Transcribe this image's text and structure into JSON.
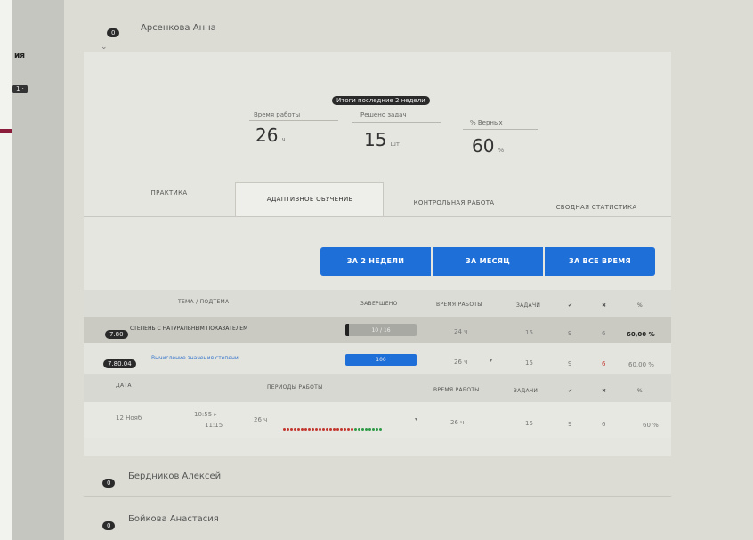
{
  "sidebar": {
    "label": "ия",
    "badge": "1 ·"
  },
  "students": [
    {
      "badge": "0",
      "name": "Арсенкова Анна"
    },
    {
      "badge": "0",
      "name": "Бердников Алексей"
    },
    {
      "badge": "0",
      "name": "Бойкова Анастасия"
    }
  ],
  "summary": {
    "period_label": "Итоги последние 2 недели",
    "items": [
      {
        "label": "Время работы",
        "value": "26",
        "unit": "ч"
      },
      {
        "label": "Решено задач",
        "value": "15",
        "unit": "шт"
      },
      {
        "label": "% Верных",
        "value": "60",
        "unit": "%"
      }
    ]
  },
  "tabs": [
    {
      "label": "ПРАКТИКА",
      "active": false
    },
    {
      "label": "АДАПТИВНОЕ ОБУЧЕНИЕ",
      "active": true
    },
    {
      "label": "КОНТРОЛЬНАЯ РАБОТА",
      "active": false
    },
    {
      "label": "СВОДНАЯ СТАТИСТИКА",
      "active": false
    }
  ],
  "period_buttons": [
    "ЗА 2 НЕДЕЛИ",
    "ЗА МЕСЯЦ",
    "ЗА ВСЕ ВРЕМЯ"
  ],
  "table": {
    "headers": [
      "ТЕМА / ПОДТЕМА",
      "ЗАВЕРШЕНО",
      "ВРЕМЯ РАБОТЫ",
      "ЗАДАЧИ",
      "✔",
      "✖",
      "%"
    ],
    "rows": [
      {
        "badge": "7.80",
        "topic": "СТЕПЕНЬ С НАТУРАЛЬНЫМ ПОКАЗАТЕЛЕМ",
        "progress_text": "10 / 16",
        "progress": 0.05,
        "time": "24 ч",
        "tasks": "15",
        "correct": "9",
        "wrong": "6",
        "percent": "60,00 %"
      },
      {
        "badge": "7.80.04",
        "topic": "Вычисление значения степени",
        "progress_text": "100",
        "progress": 1.0,
        "time": "26 ч",
        "tasks": "15",
        "correct": "9",
        "wrong": "6",
        "percent": "60,00 %"
      }
    ],
    "detail_headers": [
      "ДАТА",
      "ПЕРИОДЫ РАБОТЫ",
      "ВРЕМЯ РАБОТЫ",
      "ЗАДАЧИ",
      "✔",
      "✖",
      "%"
    ],
    "detail_rows": [
      {
        "date": "12 Нояб",
        "start": "10:55 ▸",
        "end": "11:15",
        "duration": "26 ч",
        "time": "26 ч",
        "tasks": "15",
        "correct": "9",
        "wrong": "6",
        "percent": "60 %"
      }
    ]
  },
  "colors": {
    "accent": "#1f6fd8",
    "dot_red": "#c2362f",
    "dot_green": "#2e9a48"
  }
}
